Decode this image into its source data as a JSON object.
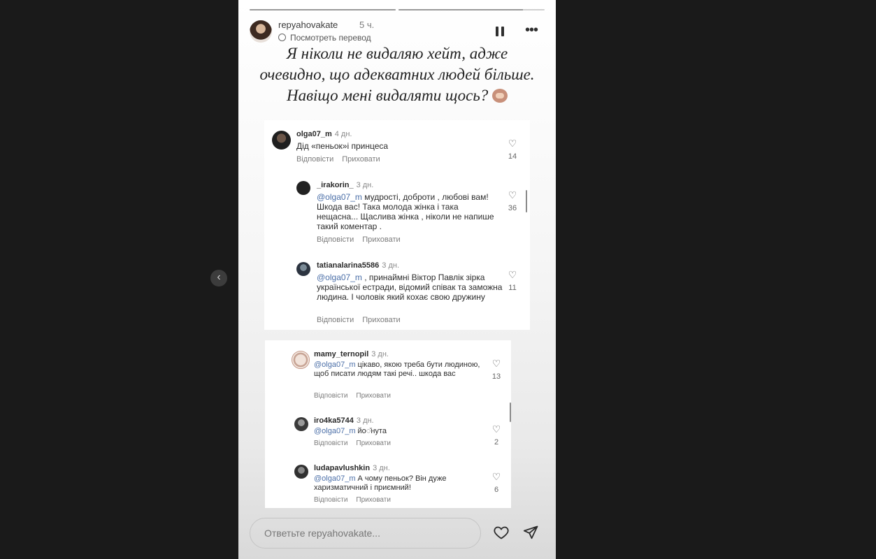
{
  "story": {
    "username": "repyahovakate",
    "time": "5 ч.",
    "translate_label": "Посмотреть перевод",
    "progress": [
      1.0,
      0.85
    ],
    "headline_lines": [
      "Я ніколи не видаляю хейт, адже",
      "очевидно, що адекватних людей більше.",
      "Навіщо мені видаляти щось?"
    ],
    "emoji_name": "see-no-evil-monkey-emoji"
  },
  "panel1": {
    "comments": [
      {
        "user": "olga07_m",
        "time": "4 дн.",
        "mention": "",
        "text": "Дід «пеньок»і принцеса",
        "likes": "14",
        "reply": "Відповісти",
        "hide": "Приховати"
      },
      {
        "user": "_irakorin_",
        "time": "3 дн.",
        "mention": "@olga07_m",
        "text": " мудрості, доброти , любові вам! Шкода вас! Така молода жінка і така нещасна... Щаслива жінка , ніколи не напише такий коментар .",
        "likes": "36",
        "reply": "Відповісти",
        "hide": "Приховати"
      },
      {
        "user": "tatianalarina5586",
        "time": "3 дн.",
        "mention": "@olga07_m",
        "text": " , принаймні Віктор Павлік зірка української естради, відомий співак та заможна людина. І чоловік який кохає свою дружину",
        "likes": "11",
        "reply": "Відповісти",
        "hide": "Приховати"
      }
    ]
  },
  "panel2": {
    "comments": [
      {
        "user": "mamy_ternopil",
        "time": "3 дн.",
        "mention": "@olga07_m",
        "text": " цікаво, якою треба бути людиною, щоб писати людям такі речі.. шкода вас",
        "likes": "13",
        "reply": "Відповісти",
        "hide": "Приховати"
      },
      {
        "user": "iro4ka5744",
        "time": "3 дн.",
        "mention": "@olga07_m",
        "text": " йо◌̆нута",
        "likes": "2",
        "reply": "Відповісти",
        "hide": "Приховати"
      },
      {
        "user": "ludapavlushkin",
        "time": "3 дн.",
        "mention": "@olga07_m",
        "text": " А чому пеньок? Він дуже харизматичний і приємний!",
        "likes": "6",
        "reply": "Відповісти",
        "hide": "Приховати"
      }
    ]
  },
  "footer": {
    "reply_placeholder": "Ответьте repyahovakate..."
  },
  "colors": {
    "page_bg": "#1a1a1a",
    "mention": "#4a6ea7",
    "panel": "#ffffff"
  }
}
